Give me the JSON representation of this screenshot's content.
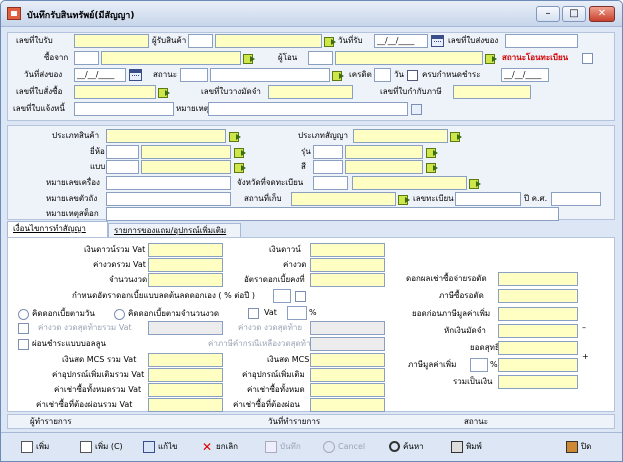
{
  "window": {
    "title": "บันทึกรับสินทรัพย์(มีสัญญา)",
    "min": "–",
    "max": "□",
    "close": "✕"
  },
  "header": {
    "receipt_no": "เลขที่ใบรับ",
    "receiver": "ผู้รับสินค้า",
    "receive_date": "วันที่รับ",
    "date_value": "__/__/____",
    "delivery_no": "เลขที่ใบส่งของ",
    "buy_from": "ซื้อจาก",
    "transferor": "ผู้โอน",
    "transfer_status": "สถานะโอนทะเบียน",
    "delivery_date": "วันที่ส่งของ",
    "delivery_date_value": "__/__/____",
    "status": "สถานะ",
    "credit": "เครดิต",
    "days": "วัน",
    "due": "ครบกำหนดชำระ",
    "due_value": "__/__/____",
    "po_no": "เลขที่ใบสั่งซื้อ",
    "deposit_no": "เลขที่ใบวางมัดจำ",
    "tax_no": "เลขที่ใบกำกับภาษี",
    "notify_no": "เลขที่ใบแจ้งหนี้",
    "note": "หมายเหตุ"
  },
  "asset": {
    "product_type": "ประเภทสินค้า",
    "contract_type": "ประเภทสัญญา",
    "brand": "ยี่ห้อ",
    "model": "รุ่น",
    "style": "แบบ",
    "color": "สี",
    "chassis": "หมายเลขเครื่อง",
    "reg_province": "จังหวัดที่จดทะเบียน",
    "body_no": "หมายเลขตัวถัง",
    "storage": "สถานที่เก็บ",
    "reg_no": "เลขทะเบียน",
    "year": "ปี ค.ศ.",
    "more_note": "หมายเหตุสต็อก"
  },
  "tabs": [
    {
      "label": "เงื่อนไขการทำสัญญา"
    },
    {
      "label": "รายการของแถม/อุปกรณ์เพิ่มเติม"
    }
  ],
  "contract": {
    "down_total_vat": "เงินดาวน์รวม Vat",
    "down": "เงินดาวน์",
    "period_total_vat": "ค่างวดรวม Vat",
    "period": "ค่างวด",
    "num_periods": "จำนวนงวด",
    "rate": "อัตราดอกเบี้ยคงที่",
    "eff_rate": "กำหนดอัตราดอกเบี้ยแบบลดต้นลดดอกเอง ( % ต่อปี )",
    "by_day": "คิดดอกเบี้ยตามวัน",
    "by_period": "คิดดอกเบี้ยตามจำนวนงวด",
    "vat": "Vat",
    "pct": "%",
    "last_period_vat": "ค่างวด งวดสุดท้ายรวม Vat",
    "last_period": "ค่างวด งวดสุดท้าย",
    "balloon": "ผ่อนชำระแบบบอลลูน",
    "remain_tax": "ค่าภาษีคำกรณีเหลืองวดสุดท้าย",
    "mcs_vat": "เงินสด MCS รวม Vat",
    "mcs": "เงินสด MCS",
    "acc_vat": "ค่าอุปกรณ์เพิ่มเติมรวม Vat",
    "acc": "ค่าอุปกรณ์เพิ่มเติม",
    "rent_vat": "ค่าเช่าซื้อทั้งหมดรวม Vat",
    "rent": "ค่าเช่าซื้อทั้งหมด",
    "rent_left_vat": "ค่าเช่าซื้อที่ต้องผ่อนรวม Vat",
    "rent_left": "ค่าเช่าซื้อที่ต้องผ่อน",
    "int_pay": "ดอกผลเช่าซื้อจ่ายรอตัด",
    "vat_pay": "ภาษีซื้อรอตัด",
    "bal_before": "ยอดก่อนภาษีมูลค่าเพิ่ม",
    "deposit": "หักเงินมัดจำ",
    "net": "ยอดสุทธิ",
    "vat_add": "ภาษีมูลค่าเพิ่ม",
    "total": "รวมเป็นเงิน",
    "minus": "–",
    "plus": "+"
  },
  "footer": {
    "maker": "ผู้ทำรายการ",
    "date": "วันที่ทำรายการ",
    "status": "สถานะ"
  },
  "toolbar": {
    "add": "เพิ่ม",
    "add_c": "เพิ่ม (C)",
    "edit": "แก้ไข",
    "cancel_doc": "ยกเลิก",
    "save": "บันทึก",
    "cancel": "Cancel",
    "search": "ค้นหา",
    "print": "พิมพ์",
    "close": "ปิด"
  }
}
